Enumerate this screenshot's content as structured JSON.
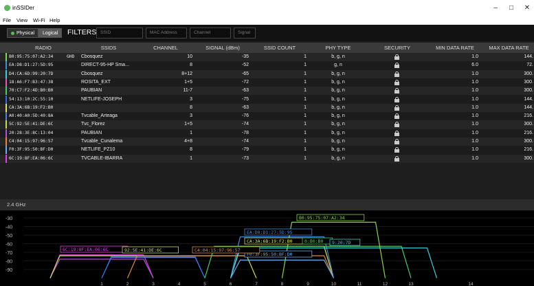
{
  "app": {
    "title": "inSSIDer"
  },
  "window_controls": {
    "minimize": "–",
    "maximize": "□",
    "close": "✕"
  },
  "menu": [
    "File",
    "View",
    "Wi-Fi",
    "Help"
  ],
  "view_toggle": {
    "physical": "Physical",
    "logical": "Logical"
  },
  "filters": {
    "label": "FILTERS:",
    "ssid_placeholder": "SSID",
    "mac_placeholder": "MAC Address",
    "channel_placeholder": "Channel",
    "signal_placeholder": "Signal"
  },
  "columns": [
    "RADIO",
    "SSIDS",
    "CHANNEL",
    "SIGNAL (dBm)",
    "SSID COUNT",
    "PHY TYPE",
    "SECURITY",
    "MIN DATA RATE",
    "MAX DATA RATE"
  ],
  "rows": [
    {
      "radio": "B0:95:75:07:A2:34",
      "ghz": "GHD",
      "ssid": "Cbosquez",
      "channel": "10",
      "signal": "-35",
      "count": "1",
      "phy": "b, g, n",
      "min": "1.0",
      "max": "144.",
      "color": "#84d94b"
    },
    {
      "radio": "EA:D8:D1:27:5D:95",
      "ghz": "",
      "ssid": "DIRECT-95-HP Sma...",
      "channel": "8",
      "signal": "-52",
      "count": "1",
      "phy": "g, n",
      "min": "6.0",
      "max": "72.",
      "color": "#3f8fe0"
    },
    {
      "radio": "D4:CA:6D:99:20:7D",
      "ghz": "",
      "ssid": "Cbosquez",
      "channel": "8+12",
      "signal": "-65",
      "count": "1",
      "phy": "b, g, n",
      "min": "1.0",
      "max": "300.",
      "color": "#3ad1e0"
    },
    {
      "radio": "18:A6:F7:B3:47:38",
      "ghz": "",
      "ssid": "ROSITA_EXT",
      "channel": "1+5",
      "signal": "-72",
      "count": "1",
      "phy": "b, g, n",
      "min": "1.0",
      "max": "300.",
      "color": "#e05ab8"
    },
    {
      "radio": "70:C7:F2:4D:B0:B0",
      "ghz": "",
      "ssid": "PAUBIAN",
      "channel": "11-7",
      "signal": "-63",
      "count": "1",
      "phy": "b, g, n",
      "min": "1.0",
      "max": "300.",
      "color": "#48d060"
    },
    {
      "radio": "54:13:10:2C:55:10",
      "ghz": "",
      "ssid": "NETLIFE-JOSEPH",
      "channel": "3",
      "signal": "-75",
      "count": "1",
      "phy": "b, g, n",
      "min": "1.0",
      "max": "144.",
      "color": "#2f6fe0"
    },
    {
      "radio": "CA:3A:6B:19:F2:B0",
      "ghz": "",
      "ssid": "",
      "channel": "8",
      "signal": "-63",
      "count": "1",
      "phy": "b, g, n",
      "min": "1.0",
      "max": "144.",
      "color": "#e3e35a"
    },
    {
      "radio": "A0:40:A0:5D:40:8A",
      "ghz": "",
      "ssid": "Tvcable_Arteaga",
      "channel": "3",
      "signal": "-76",
      "count": "1",
      "phy": "b, g, n",
      "min": "1.0",
      "max": "216.",
      "color": "#5a7be0"
    },
    {
      "radio": "5C:92:5E:41:DE:6C",
      "ghz": "",
      "ssid": "Tvc_Florez",
      "channel": "1+5",
      "signal": "-74",
      "count": "1",
      "phy": "b, g, n",
      "min": "1.0",
      "max": "300.",
      "color": "#c7e04a"
    },
    {
      "radio": "20:28:3E:8C:13:04",
      "ghz": "",
      "ssid": "PAUBIAN",
      "channel": "1",
      "signal": "-78",
      "count": "1",
      "phy": "b, g, n",
      "min": "1.0",
      "max": "216.",
      "color": "#b050e0"
    },
    {
      "radio": "C4:04:15:97:96:57",
      "ghz": "",
      "ssid": "Tvcable_Cunalema",
      "channel": "4+8",
      "signal": "-74",
      "count": "1",
      "phy": "b, g, n",
      "min": "1.0",
      "max": "300.",
      "color": "#e08a3a"
    },
    {
      "radio": "F0:3F:95:50:BF:D0",
      "ghz": "",
      "ssid": "NETLIFE_PZ10",
      "channel": "8",
      "signal": "-79",
      "count": "1",
      "phy": "b, g, n",
      "min": "1.0",
      "max": "216.",
      "color": "#6ab0f0"
    },
    {
      "radio": "6C:19:8F:EA:06:6C",
      "ghz": "",
      "ssid": "TVCABLE-IBARRA",
      "channel": "1",
      "signal": "-73",
      "count": "1",
      "phy": "b, g, n",
      "min": "1.0",
      "max": "300.",
      "color": "#e040e0"
    }
  ],
  "graph": {
    "band_label": "2.4 GHz",
    "y_ticks": [
      "-30",
      "-40",
      "-50",
      "-60",
      "-70",
      "-80",
      "-90"
    ],
    "x_ticks": [
      "1",
      "2",
      "3",
      "4",
      "5",
      "6",
      "7",
      "8",
      "9",
      "10",
      "11",
      "12",
      "13",
      "14"
    ],
    "tags": [
      {
        "text": "B0:95:75:07:A2:34",
        "color": "#84d94b"
      },
      {
        "text": "EA:D8:D1:27:5D:95",
        "color": "#3f8fe0"
      },
      {
        "text": "CA:3A:6B:19:F2:B0",
        "color": "#e3e35a"
      },
      {
        "text": "0:B0:B0",
        "color": "#48d060"
      },
      {
        "text": "9:20:7D",
        "color": "#3ad1e0"
      },
      {
        "text": "F0:3F:95:50:BF:D0",
        "color": "#6ab0f0"
      },
      {
        "text": "6C:19:8F:EA:06:6C",
        "color": "#e040e0"
      },
      {
        "text": "92:5E:41:DE:6C",
        "color": "#c7e04a"
      },
      {
        "text": "C4:04:15:97:96:57",
        "color": "#e08a3a"
      }
    ]
  }
}
